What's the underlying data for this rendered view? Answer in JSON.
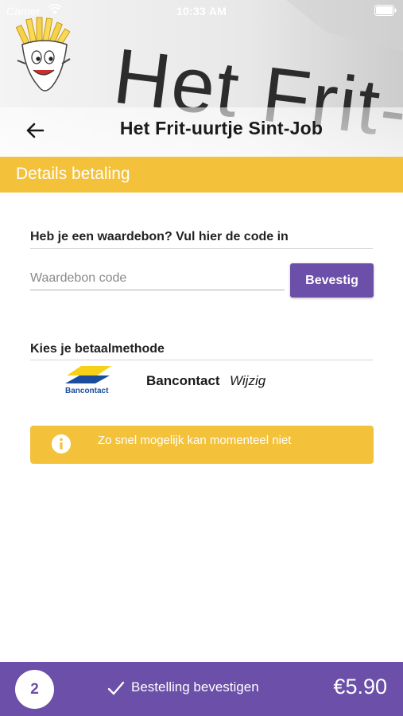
{
  "status_bar": {
    "carrier": "Carrier",
    "time": "10:33 AM"
  },
  "header": {
    "title": "Het Frit-uurtje Sint-Job",
    "signage_text": "Het Frit-uurtje",
    "back_icon": "arrow-left-icon",
    "logo_icon": "fries-mascot-logo"
  },
  "section": {
    "title": "Details betaling"
  },
  "voucher": {
    "label": "Heb je een waardebon? Vul hier de code in",
    "placeholder": "Waardebon code",
    "value": "",
    "button_label": "Bevestig"
  },
  "payment": {
    "label": "Kies je betaalmethode",
    "method": "Bancontact",
    "change_label": "Wijzig",
    "logo_text": "Bancontact"
  },
  "info": {
    "icon": "info-icon",
    "message": "Zo snel mogelijk kan momenteel niet"
  },
  "footer": {
    "item_count": "2",
    "confirm_label": "Bestelling bevestigen",
    "total": "€5.90"
  },
  "colors": {
    "accent_yellow": "#f3c13a",
    "brand_purple": "#6b4fa8",
    "bancontact_blue": "#1c4c9c",
    "bancontact_yellow": "#f7d117"
  }
}
